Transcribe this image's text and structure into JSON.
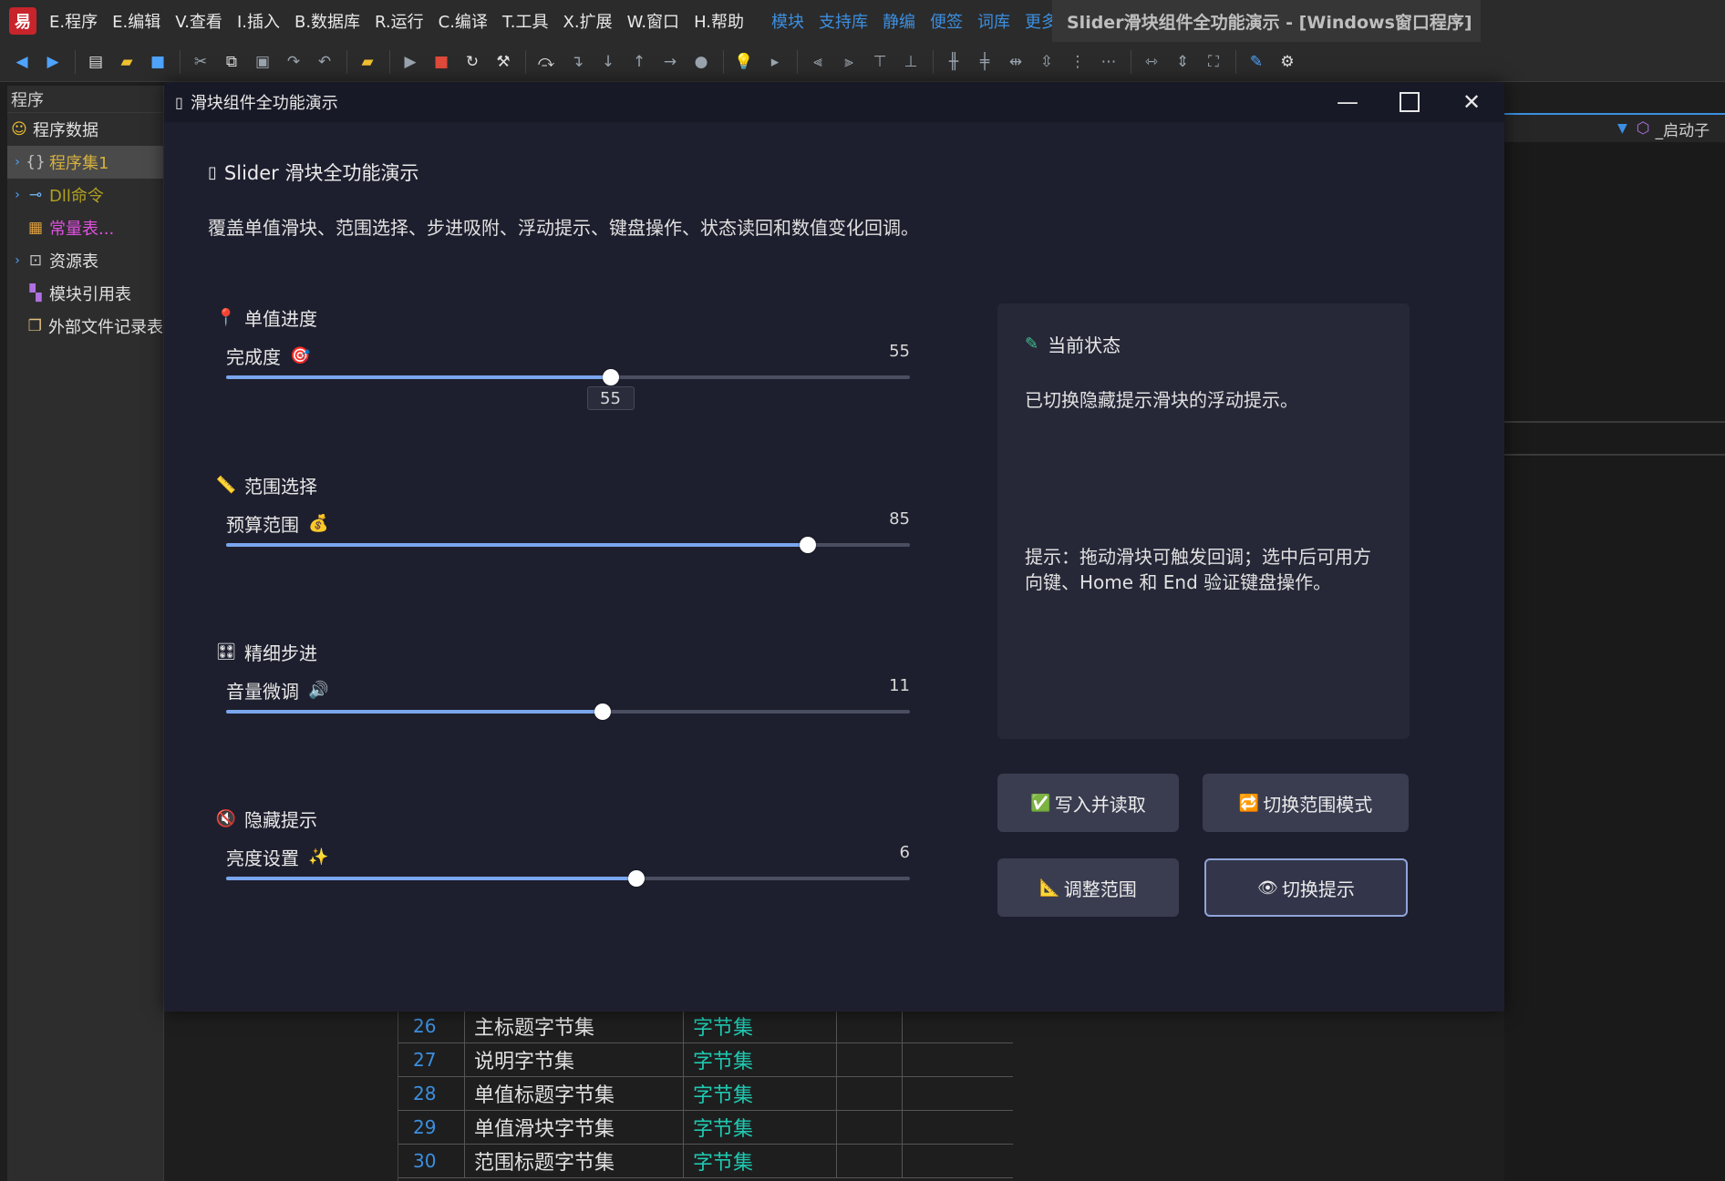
{
  "ide": {
    "logo": "易",
    "menus": [
      "E.程序",
      "E.编辑",
      "V.查看",
      "I.插入",
      "B.数据库",
      "R.运行",
      "C.编译",
      "T.工具",
      "X.扩展",
      "W.窗口",
      "H.帮助"
    ],
    "blue_menus": [
      "模块",
      "支持库",
      "静编",
      "便签",
      "词库",
      "更多"
    ],
    "title": "Slider滑块组件全功能演示 - [Windows窗口程序]",
    "left_panel": {
      "header": "程序",
      "items": [
        {
          "label": "程序数据",
          "icon": "smiley-icon"
        },
        {
          "label": "程序集1",
          "icon": "braces-icon"
        },
        {
          "label": "Dll命令",
          "icon": "plug-icon"
        },
        {
          "label": "常量表...",
          "icon": "table-icon"
        },
        {
          "label": "资源表",
          "icon": "resource-icon"
        },
        {
          "label": "模块引用表",
          "icon": "module-icon"
        },
        {
          "label": "外部文件记录表",
          "icon": "file-icon"
        }
      ]
    },
    "right_tab": {
      "label": "_启动子"
    },
    "code_rows": [
      {
        "num": "26",
        "name": "主标题字节集",
        "type": "字节集"
      },
      {
        "num": "27",
        "name": "说明字节集",
        "type": "字节集"
      },
      {
        "num": "28",
        "name": "单值标题字节集",
        "type": "字节集"
      },
      {
        "num": "29",
        "name": "单值滑块字节集",
        "type": "字节集"
      },
      {
        "num": "30",
        "name": "范围标题字节集",
        "type": "字节集"
      }
    ]
  },
  "window": {
    "title": "滑块组件全功能演示",
    "heading": "Slider 滑块全功能演示",
    "description": "覆盖单值滑块、范围选择、步进吸附、浮动提示、键盘操作、状态读回和数值变化回调。",
    "sections": [
      {
        "title": "单值进度",
        "title_icon": "📍",
        "label": "完成度",
        "label_icon": "🎯",
        "value": "55",
        "fraction": 0.562,
        "tooltip": "55",
        "show_tooltip": true
      },
      {
        "title": "范围选择",
        "title_icon": "📏",
        "label": "预算范围",
        "label_icon": "💰",
        "value": "85",
        "fraction": 0.85,
        "show_tooltip": false
      },
      {
        "title": "精细步进",
        "title_icon": "🎛",
        "label": "音量微调",
        "label_icon": "🔊",
        "value": "11",
        "fraction": 0.55,
        "show_tooltip": false
      },
      {
        "title": "隐藏提示",
        "title_icon": "🔇",
        "label": "亮度设置",
        "label_icon": "✨",
        "value": "6",
        "fraction": 0.6,
        "show_tooltip": false
      }
    ],
    "status": {
      "title": "当前状态",
      "message": "已切换隐藏提示滑块的浮动提示。",
      "hint": "提示：拖动滑块可触发回调；选中后可用方向键、Home 和 End 验证键盘操作。"
    },
    "buttons": {
      "write_read": "写入并读取",
      "toggle_range_mode": "切换范围模式",
      "adjust_range": "调整范围",
      "toggle_tooltip": "切换提示"
    },
    "colors": {
      "accent": "#7aa6ee",
      "track": "#4a4e60",
      "background": "#1e1f2e"
    }
  }
}
